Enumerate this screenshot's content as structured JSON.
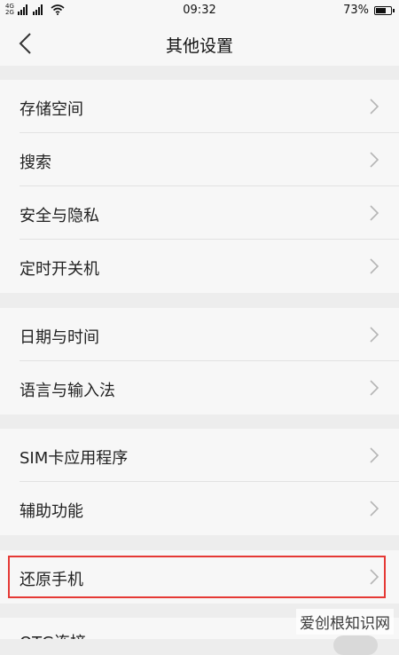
{
  "status_bar": {
    "network_top": "4G",
    "network_bottom": "2G",
    "time": "09:32",
    "battery": "73%",
    "battery_level": 0.73
  },
  "header": {
    "title": "其他设置",
    "back_icon": "chevron-left-icon"
  },
  "groups": [
    {
      "items": [
        {
          "label": "存储空间"
        },
        {
          "label": "搜索"
        },
        {
          "label": "安全与隐私"
        },
        {
          "label": "定时开关机"
        }
      ]
    },
    {
      "items": [
        {
          "label": "日期与时间"
        },
        {
          "label": "语言与输入法"
        }
      ]
    },
    {
      "items": [
        {
          "label": "SIM卡应用程序"
        },
        {
          "label": "辅助功能"
        }
      ]
    },
    {
      "items": [
        {
          "label": "还原手机"
        }
      ]
    },
    {
      "items": [
        {
          "label": "OTG连接"
        }
      ]
    }
  ],
  "highlight_color": "#e53935",
  "watermark": "爱创根知识网"
}
